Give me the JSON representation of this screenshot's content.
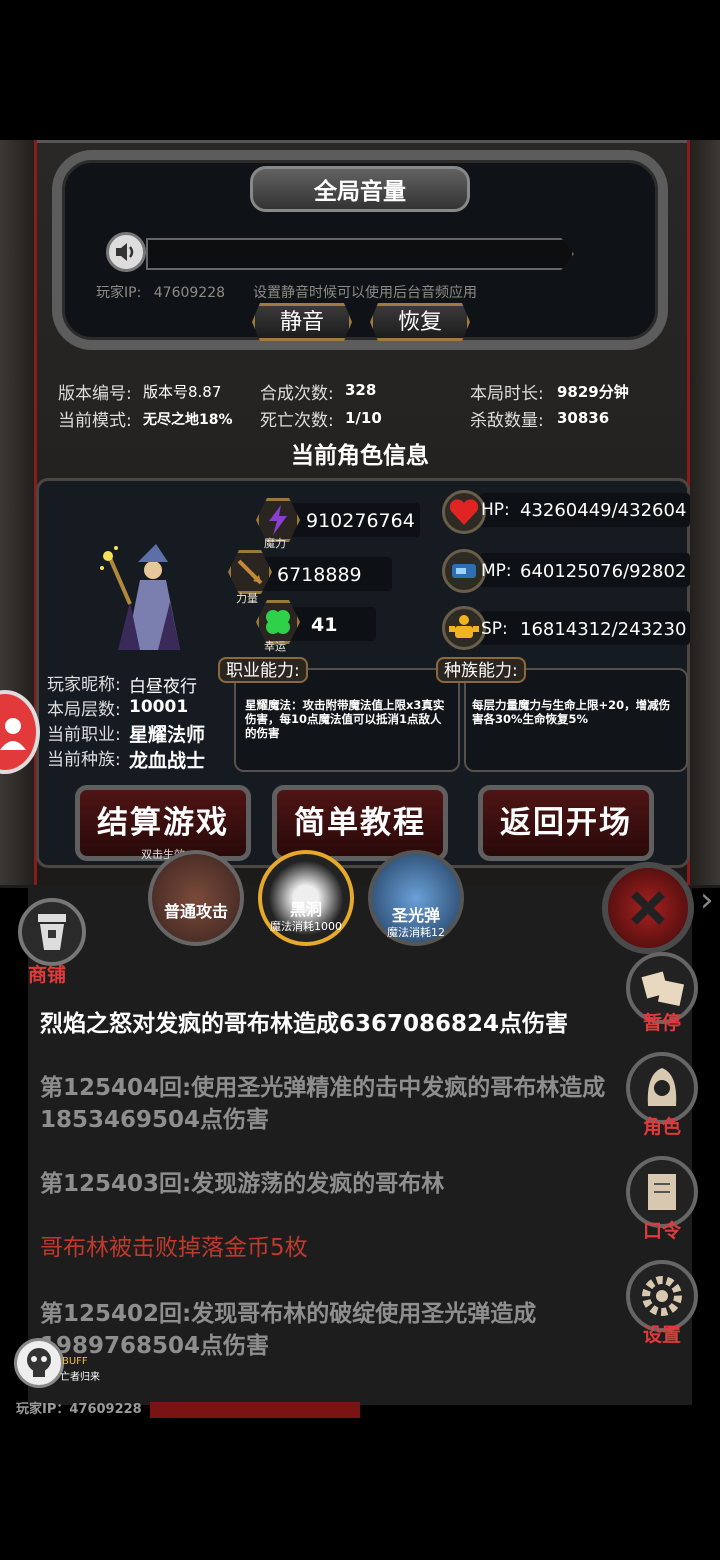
{
  "volume": {
    "title": "全局音量",
    "player_ip_label": "玩家IP:",
    "player_ip": "47609228",
    "hint": "设置静音时候可以使用后台音频应用",
    "mute_button": "静音",
    "restore_button": "恢复"
  },
  "stats": {
    "version_label": "版本编号:",
    "version_value": "版本号8.87",
    "mode_label": "当前模式:",
    "mode_value": "无尽之地18%",
    "merge_label": "合成次数:",
    "merge_value": "328",
    "death_label": "死亡次数:",
    "death_value": "1/10",
    "duration_label": "本局时长:",
    "duration_value": "9829分钟",
    "kills_label": "杀敌数量:",
    "kills_value": "30836"
  },
  "character": {
    "section_title": "当前角色信息",
    "magic_value": "910276764",
    "magic_tag": "魔力",
    "strength_value": "6718889",
    "strength_tag": "力量",
    "luck_value": "41",
    "luck_tag": "幸运",
    "hp_label": "HP:",
    "hp_value": "43260449/432604",
    "mp_label": "MP:",
    "mp_value": "640125076/92802",
    "sp_label": "SP:",
    "sp_value": "16814312/243230",
    "nickname_label": "玩家昵称:",
    "nickname": "白昼夜行",
    "floor_label": "本局层数:",
    "floor": "10001",
    "class_label": "当前职业:",
    "class": "星耀法师",
    "race_label": "当前种族:",
    "race": "龙血战士",
    "class_ability_title": "职业能力:",
    "class_ability_text": "星耀魔法：攻击附带魔法值上限x3真实伤害，每10点魔法值可以抵消1点敌人的伤害",
    "race_ability_title": "种族能力:",
    "race_ability_text": "每层力量魔力与生命上限+20，增减伤害各30%生命恢复5%"
  },
  "actions": {
    "settle_button": "结算游戏",
    "settle_sub": "双击生效",
    "tutorial_button": "简单教程",
    "back_button": "返回开场"
  },
  "skills": [
    {
      "name": "普通攻击",
      "cost": ""
    },
    {
      "name": "黑洞",
      "cost": "魔法消耗1000"
    },
    {
      "name": "圣光弹",
      "cost": "魔法消耗12"
    }
  ],
  "left_menu": {
    "shop_label": "商铺",
    "buff_label": "BUFF",
    "buff_sub": "亡者归来",
    "ip_footer": "玩家IP：47609228"
  },
  "right_menu": {
    "pause": "暂停",
    "role": "角色",
    "password": "口令",
    "settings": "设置"
  },
  "log": [
    {
      "text": "烈焰之怒对发疯的哥布林造成6367086824点伤害",
      "color": "#ffffff"
    },
    {
      "text": "第125404回:使用圣光弹精准的击中发疯的哥布林造成1853469504点伤害",
      "color": "#8e8e8e"
    },
    {
      "text": "第125403回:发现游荡的发疯的哥布林",
      "color": "#8e8e8e"
    },
    {
      "text": "哥布林被击败掉落金币5枚",
      "color": "#c0392b"
    },
    {
      "text": "第125402回:发现哥布林的破绽使用圣光弹造成1989768504点伤害",
      "color": "#8e8e8e"
    }
  ]
}
